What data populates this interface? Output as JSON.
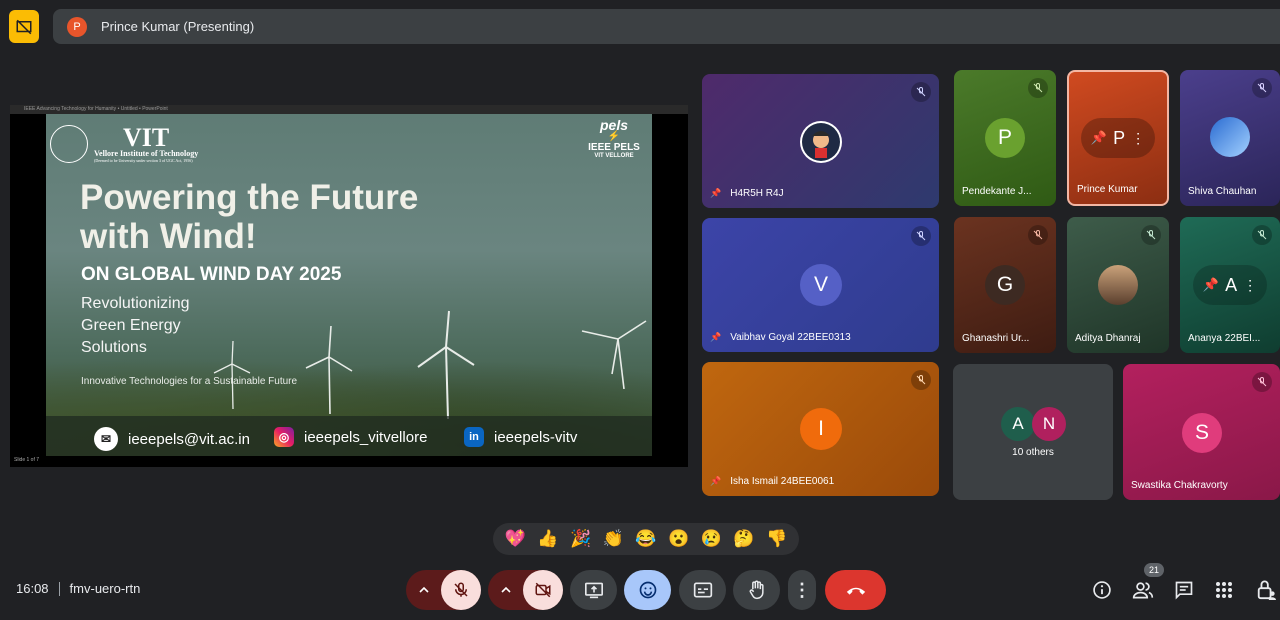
{
  "presenter": {
    "initial": "P",
    "label": "Prince Kumar (Presenting)"
  },
  "slide": {
    "window_title": "IEEE Advancing Technology for Humanity • Untitled • PowerPoint",
    "vit_name": "VIT",
    "vit_full": "Vellore Institute of Technology",
    "vit_note": "(Deemed to be University under section 3 of UGC Act, 1956)",
    "pels_logo": "pels",
    "pels_text": "IEEE PELS",
    "pels_sub": "VIT VELLORE",
    "title_line1": "Powering the Future",
    "title_line2": "with Wind!",
    "subtitle": "ON GLOBAL WIND DAY 2025",
    "desc_line1": "Revolutionizing",
    "desc_line2": "Green Energy",
    "desc_line3": "Solutions",
    "tagline": "Innovative Technologies for a Sustainable Future",
    "email": "ieeepels@vit.ac.in",
    "instagram": "ieeepels_vitvellore",
    "linkedin": "ieeepels-vitv",
    "status": "Slide 1 of 7"
  },
  "participants": [
    {
      "name": "H4R5H R4J",
      "color": "#4a2e6b"
    },
    {
      "name": "Pendekante J...",
      "initial": "P",
      "color": "#3f6f1f"
    },
    {
      "name": "Prince Kumar",
      "initial": "P",
      "color": "#c0421c"
    },
    {
      "name": "Shiva Chauhan",
      "color": "#3b2f6e"
    },
    {
      "name": "Vaibhav Goyal 22BEE0313",
      "initial": "V",
      "color": "#3f47a8"
    },
    {
      "name": "Ghanashri Ur...",
      "initial": "G",
      "color": "#5a2f1e"
    },
    {
      "name": "Aditya Dhanraj",
      "color": "#2d4e3c"
    },
    {
      "name": "Ananya 22BEI...",
      "initial": "A",
      "color": "#1d5a4a"
    },
    {
      "name": "Isha Ismail 24BEE0061",
      "initial": "I",
      "color": "#b85a10"
    },
    {
      "name": "10 others",
      "initials": [
        "A",
        "N"
      ]
    },
    {
      "name": "Swastika Chakravorty",
      "initial": "S",
      "color": "#a81c5a"
    }
  ],
  "reactions": [
    "💖",
    "👍",
    "🎉",
    "👏",
    "😂",
    "😮",
    "😢",
    "🤔",
    "👎"
  ],
  "footer": {
    "time": "16:08",
    "meeting_code": "fmv-uero-rtn",
    "people_count": "21"
  }
}
